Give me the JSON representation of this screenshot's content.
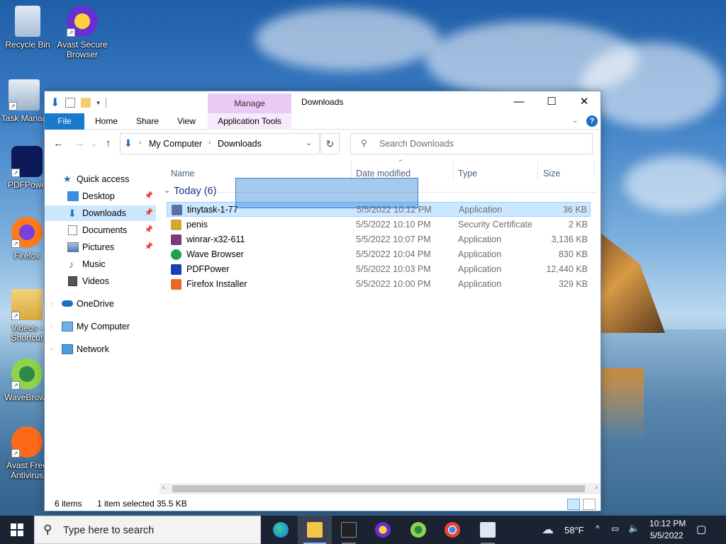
{
  "desktop": {
    "icons": [
      {
        "label": "Recycle Bin"
      },
      {
        "label": "Avast Secure Browser"
      },
      {
        "label": "Task Manag"
      },
      {
        "label": "PDFPowe"
      },
      {
        "label": "Firefox"
      },
      {
        "label": "Videos - Shortcut"
      },
      {
        "label": "WaveBrows"
      },
      {
        "label": "Avast Free Antivirus"
      }
    ]
  },
  "window": {
    "title": "Downloads",
    "manage_tab": "Manage",
    "ribbon_tabs": {
      "file": "File",
      "home": "Home",
      "share": "Share",
      "view": "View",
      "app_tools": "Application Tools"
    },
    "address": {
      "root": "My Computer",
      "current": "Downloads"
    },
    "search_placeholder": "Search Downloads",
    "columns": {
      "name": "Name",
      "date": "Date modified",
      "type": "Type",
      "size": "Size"
    },
    "group_label": "Today (6)",
    "files": [
      {
        "name": "tinytask-1-77",
        "date": "5/5/2022 10:12 PM",
        "type": "Application",
        "size": "36 KB",
        "color": "#5a6ea8"
      },
      {
        "name": "penis",
        "date": "5/5/2022 10:10 PM",
        "type": "Security Certificate",
        "size": "2 KB",
        "color": "#d4a830"
      },
      {
        "name": "winrar-x32-611",
        "date": "5/5/2022 10:07 PM",
        "type": "Application",
        "size": "3,136 KB",
        "color": "#7a3b7a"
      },
      {
        "name": "Wave Browser",
        "date": "5/5/2022 10:04 PM",
        "type": "Application",
        "size": "830 KB",
        "color": "#1e9f5a"
      },
      {
        "name": "PDFPower",
        "date": "5/5/2022 10:03 PM",
        "type": "Application",
        "size": "12,440 KB",
        "color": "#1a3fb5"
      },
      {
        "name": "Firefox Installer",
        "date": "5/5/2022 10:00 PM",
        "type": "Application",
        "size": "329 KB",
        "color": "#e8672a"
      }
    ],
    "nav": {
      "quick_access": "Quick access",
      "desktop": "Desktop",
      "downloads": "Downloads",
      "documents": "Documents",
      "pictures": "Pictures",
      "music": "Music",
      "videos": "Videos",
      "onedrive": "OneDrive",
      "my_computer": "My Computer",
      "network": "Network"
    },
    "status": {
      "items": "6 items",
      "selected": "1 item selected",
      "size": "35.5 KB"
    }
  },
  "taskbar": {
    "search_placeholder": "Type here to search",
    "weather": "58°F",
    "time": "10:12 PM",
    "date": "5/5/2022"
  }
}
